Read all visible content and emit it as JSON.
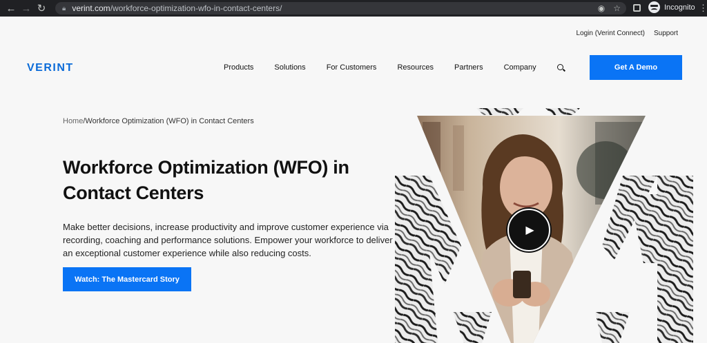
{
  "browser": {
    "url_host": "verint.com",
    "url_path": "/workforce-optimization-wfo-in-contact-centers/",
    "profile_label": "Incognito"
  },
  "utility_nav": {
    "login": "Login (Verint Connect)",
    "support": "Support"
  },
  "header": {
    "logo": "VERINT",
    "nav_items": [
      "Products",
      "Solutions",
      "For Customers",
      "Resources",
      "Partners",
      "Company"
    ],
    "cta": "Get A Demo"
  },
  "hero": {
    "breadcrumb_home": "Home",
    "breadcrumb_sep": "/",
    "breadcrumb_current": "Workforce Optimization (WFO) in Contact Centers",
    "title": "Workforce Optimization (WFO) in Contact Centers",
    "body": "Make better decisions, increase productivity and improve customer experience via recording, coaching and performance solutions. Empower your workforce to deliver an exceptional customer experience while also reducing costs.",
    "cta": "Watch: The Mastercard Story"
  },
  "colors": {
    "accent": "#0a74f5",
    "logo": "#0b6bd8",
    "chrome": "#202124"
  },
  "icons": [
    "back-arrow-icon",
    "forward-arrow-icon",
    "reload-icon",
    "lock-icon",
    "eye-off-icon",
    "star-icon",
    "tab-icon",
    "incognito-icon",
    "more-icon",
    "search-icon",
    "play-icon"
  ]
}
